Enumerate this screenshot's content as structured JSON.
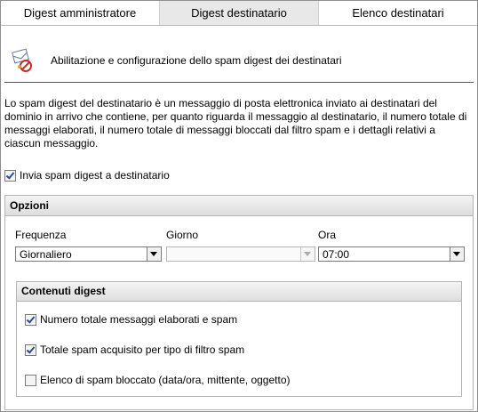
{
  "tabs": [
    {
      "label": "Digest amministratore"
    },
    {
      "label": "Digest destinatario"
    },
    {
      "label": "Elenco destinatari"
    }
  ],
  "header": {
    "title": "Abilitazione e configurazione dello spam digest dei destinatari",
    "icon": "mail-prohibited-icon"
  },
  "description": "Lo spam digest del destinatario è un messaggio di posta elettronica inviato ai destinatari del dominio in arrivo che contiene, per quanto riguarda il messaggio al destinatario, il numero totale di messaggi elaborati, il numero totale di messaggi bloccati dal filtro spam e i dettagli relativi a ciascun messaggio.",
  "enable": {
    "label": "Invia spam digest a destinatario",
    "checked": true
  },
  "options": {
    "title": "Opzioni",
    "frequency": {
      "label": "Frequenza",
      "value": "Giornaliero"
    },
    "day": {
      "label": "Giorno",
      "value": "",
      "disabled": true
    },
    "time": {
      "label": "Ora",
      "value": "07:00"
    }
  },
  "digest_contents": {
    "title": "Contenuti digest",
    "items": [
      {
        "label": "Numero totale messaggi elaborati e spam",
        "checked": true
      },
      {
        "label": "Totale spam acquisito per tipo di filtro spam",
        "checked": true
      },
      {
        "label": "Elenco di spam bloccato (data/ora, mittente, oggetto)",
        "checked": false
      }
    ]
  },
  "colors": {
    "accent": "#2a4e8f",
    "active_tab": "#e8e8e8"
  }
}
